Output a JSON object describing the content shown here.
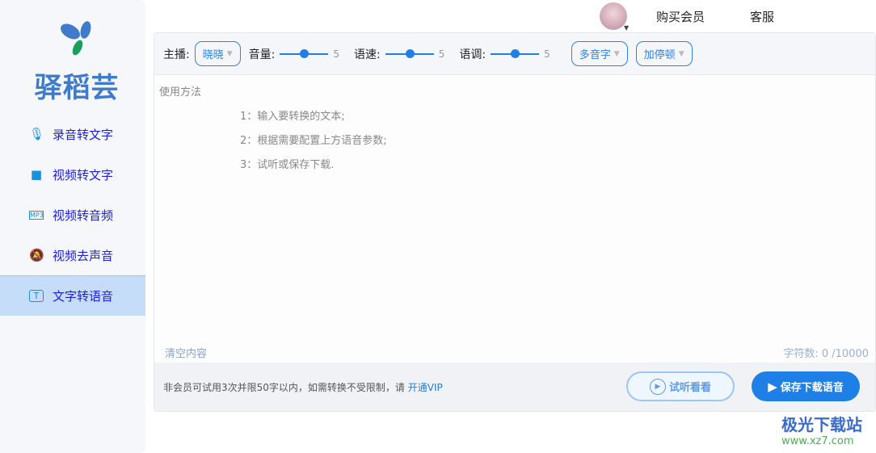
{
  "app": {
    "name": "驿稻芸"
  },
  "sidebar": {
    "items": [
      {
        "label": "录音转文字",
        "icon": "microphone-icon"
      },
      {
        "label": "视频转文字",
        "icon": "video-camera-icon"
      },
      {
        "label": "视频转音频",
        "icon": "mp3-file-icon"
      },
      {
        "label": "视频去声音",
        "icon": "bell-off-icon"
      },
      {
        "label": "文字转语音",
        "icon": "text-icon",
        "active": true
      }
    ]
  },
  "header": {
    "buy": "购买会员",
    "service": "客服"
  },
  "toolbar": {
    "anchor_label": "主播:",
    "anchor_value": "晓晓",
    "volume_label": "音量:",
    "volume_value": "5",
    "speed_label": "语速:",
    "speed_value": "5",
    "pitch_label": "语调:",
    "pitch_value": "5",
    "polyphone": "多音字",
    "pause": "加停顿"
  },
  "editor": {
    "title": "使用方法",
    "steps": [
      "1：输入要转换的文本;",
      "2：根据需要配置上方语音参数;",
      "3：试听或保存下载."
    ],
    "clear": "清空内容",
    "count": "字符数: 0 /10000"
  },
  "footer": {
    "note": "非会员可试用3次并限50字以内，如需转换不受限制，请 ",
    "vip": "开通VIP",
    "preview": "试听看看",
    "save": "保存下载语音"
  },
  "watermark": {
    "name": "极光下载站",
    "url": "www.xz7.com"
  }
}
